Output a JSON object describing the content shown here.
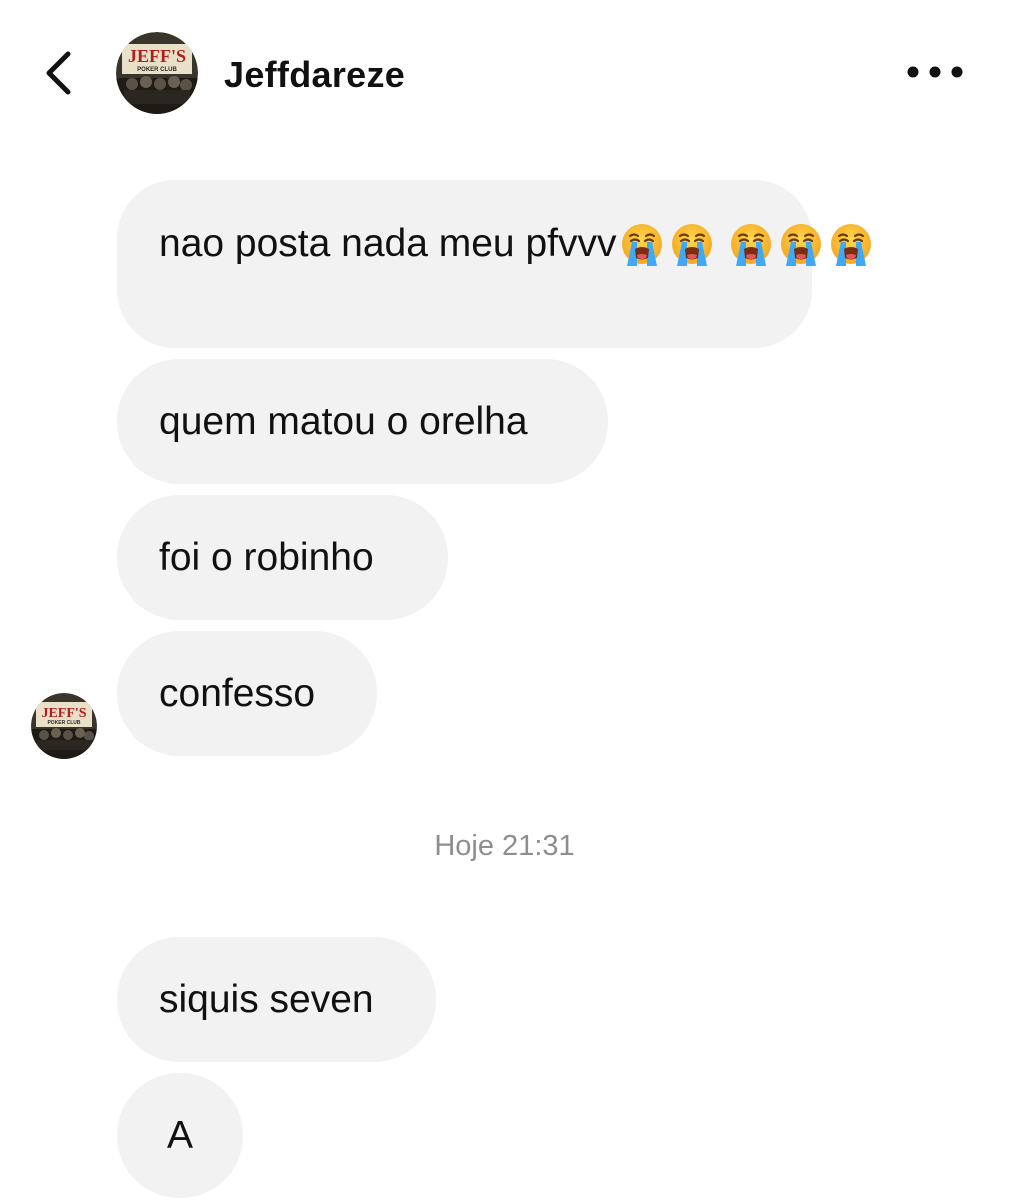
{
  "header": {
    "username": "Jeffdareze",
    "avatar_text_line1": "JEFF'S",
    "avatar_text_line2": "POKER CLUB"
  },
  "messages": [
    {
      "text": "nao posta nada meu pfvvv",
      "emoji_after": 2,
      "emoji_second_line": 3,
      "emoji_name": "loudly-crying-face"
    },
    {
      "text": "quem matou o orelha"
    },
    {
      "text": "foi o robinho"
    },
    {
      "text": "confesso"
    }
  ],
  "timestamp": "Hoje 21:31",
  "messages_after": [
    {
      "text": "siquis seven"
    },
    {
      "text": "A"
    }
  ],
  "colors": {
    "bubble_bg": "#f2f2f2",
    "timestamp": "#8e8e8e",
    "text": "#111111"
  }
}
